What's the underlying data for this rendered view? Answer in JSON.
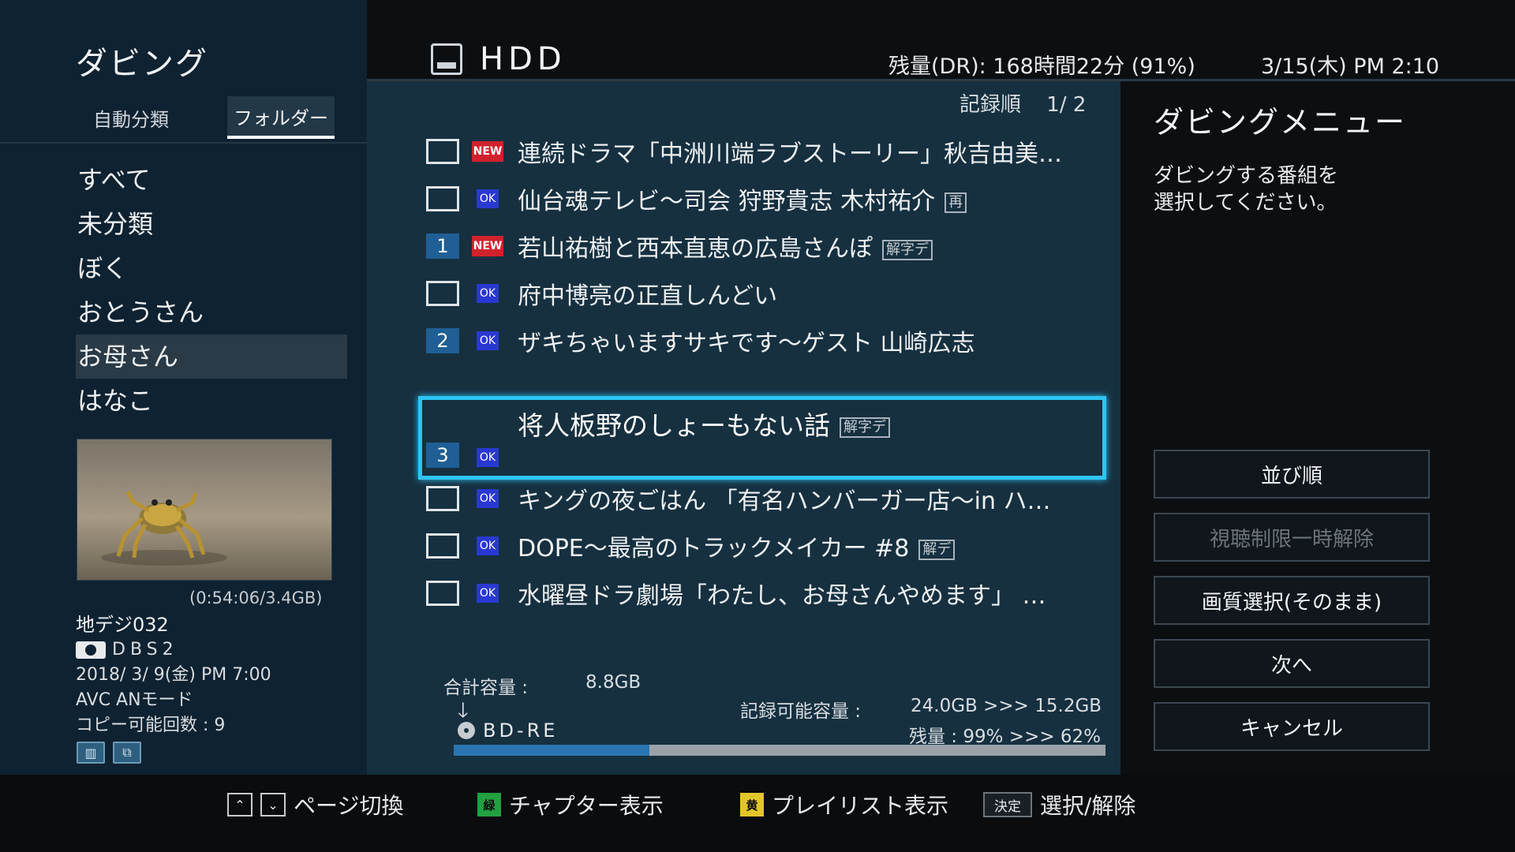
{
  "left": {
    "title": "ダビング",
    "tabs": [
      "自動分類",
      "フォルダー"
    ],
    "folders": [
      "すべて",
      "未分類",
      "ぼく",
      "おとうさん",
      "お母さん",
      "はなこ"
    ],
    "selected_folder": "お母さん",
    "duration": "(0:54:06/3.4GB)",
    "channel": "地デジ032",
    "station": "DBS2",
    "datetime": "2018/ 3/ 9(金) PM 7:00",
    "mode": "AVC ANモード",
    "copy_count": "コピー可能回数 : 9"
  },
  "header": {
    "source": "HDD",
    "remain": "残量(DR): 168時間22分 (91%)",
    "date": "3/15(木) PM 2:10"
  },
  "list": {
    "sort": "記録順",
    "page": "1/ 2",
    "rows": [
      {
        "marker": "",
        "badge": "NEW",
        "title": "連続ドラマ「中洲川端ラブストーリー」秋吉由美…",
        "tag": ""
      },
      {
        "marker": "",
        "badge": "OK",
        "title": "仙台魂テレビ〜司会 狩野貴志 木村祐介",
        "tag": "再"
      },
      {
        "marker": "1",
        "badge": "NEW",
        "title": "若山祐樹と西本直恵の広島さんぽ",
        "tag": "解字デ"
      },
      {
        "marker": "",
        "badge": "OK",
        "title": "府中博亮の正直しんどい",
        "tag": ""
      },
      {
        "marker": "2",
        "badge": "OK",
        "title": "ザキちゃいますサキです〜ゲスト 山崎広志",
        "tag": ""
      },
      {
        "marker": "3",
        "badge": "OK",
        "title": "将人板野のしょーもない話",
        "tag": "解字デ"
      },
      {
        "marker": "",
        "badge": "OK",
        "title": "キングの夜ごはん 「有名ハンバーガー店〜in ハ…",
        "tag": ""
      },
      {
        "marker": "",
        "badge": "OK",
        "title": "DOPE〜最高のトラックメイカー #8",
        "tag": "解デ"
      },
      {
        "marker": "",
        "badge": "OK",
        "title": "水曜昼ドラ劇場「わたし、お母さんやめます」 …",
        "tag": ""
      }
    ]
  },
  "capacity": {
    "total_label": "合計容量 :",
    "total_value": "8.8GB",
    "target": "BD-RE",
    "rec_label": "記録可能容量 :",
    "rec_values": "24.0GB >>> 15.2GB",
    "remain": "残量 : 99% >>> 62%",
    "used_fraction": 0.3
  },
  "menu": {
    "title": "ダビングメニュー",
    "desc_line1": "ダビングする番組を",
    "desc_line2": "選択してください。",
    "buttons": [
      "並び順",
      "視聴制限一時解除",
      "画質選択(そのまま)",
      "次へ",
      "キャンセル"
    ]
  },
  "footer": {
    "page_switch": "ページ切換",
    "chapter": "チャプター表示",
    "chapter_key": "緑",
    "playlist": "プレイリスト表示",
    "playlist_key": "黄",
    "enter_key": "決定",
    "select": "選択/解除"
  },
  "colors": {
    "focus": "#2ec5f2",
    "new_badge": "#d0222d",
    "ok_badge": "#2a38d2",
    "marker": "#1f5f95"
  }
}
